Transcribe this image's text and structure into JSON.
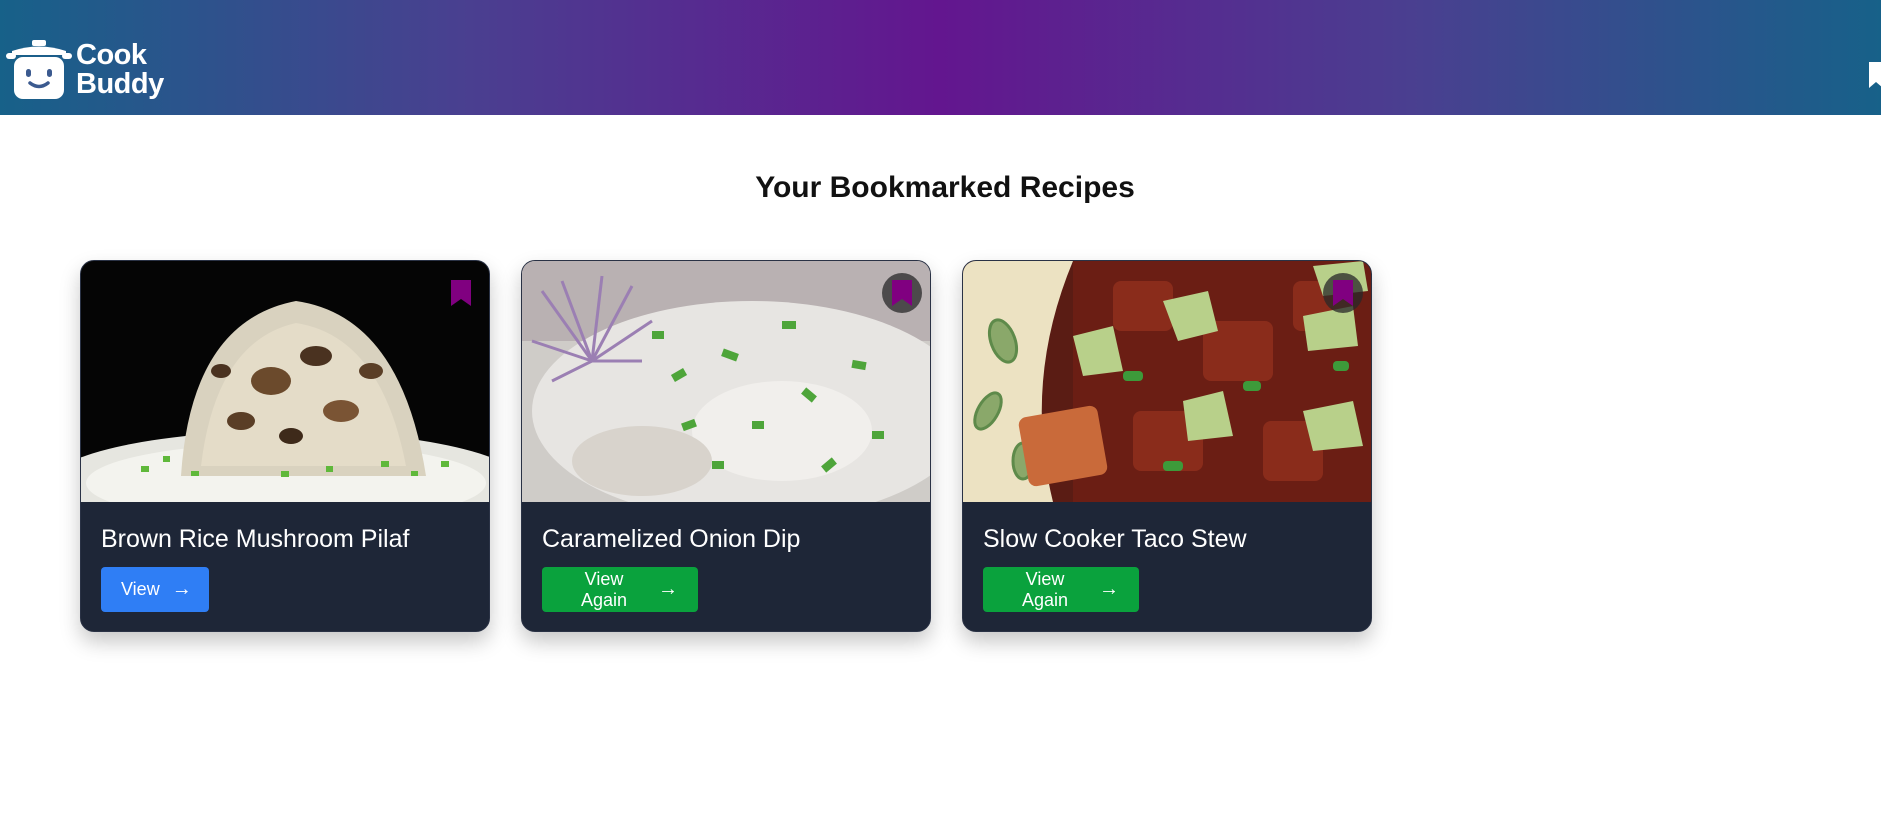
{
  "app": {
    "logo_line1": "Cook",
    "logo_line2": "Buddy"
  },
  "page": {
    "title": "Your Bookmarked Recipes"
  },
  "recipes": [
    {
      "title": "Brown Rice Mushroom Pilaf",
      "action_label": "View",
      "action_icon": "arrow-right-icon",
      "action_color": "#2f7ef5",
      "bookmarked": true
    },
    {
      "title": "Caramelized Onion Dip",
      "action_label": "View Again",
      "action_icon": "arrow-right-icon",
      "action_color": "#0aa23d",
      "bookmarked": true
    },
    {
      "title": "Slow Cooker Taco Stew",
      "action_label": "View Again",
      "action_icon": "arrow-right-icon",
      "action_color": "#0aa23d",
      "bookmarked": true
    }
  ],
  "colors": {
    "bookmark": "#800080",
    "card_bg": "#1e2637"
  }
}
